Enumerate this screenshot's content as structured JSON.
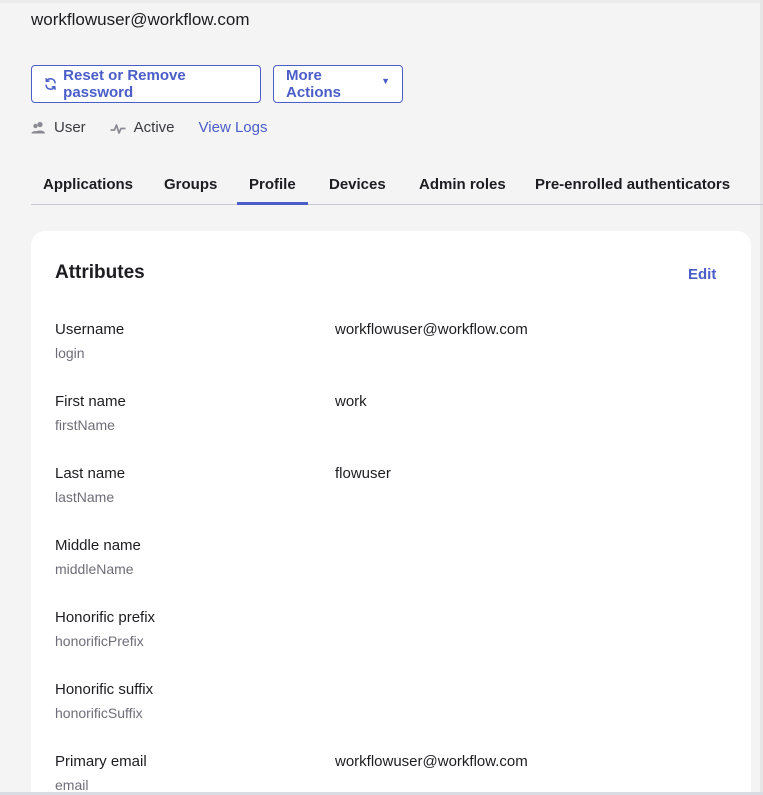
{
  "header": {
    "email": "workflowuser@workflow.com"
  },
  "actions": {
    "reset_label": "Reset or Remove password",
    "more_label": "More Actions"
  },
  "meta": {
    "role": "User",
    "status": "Active",
    "view_logs": "View Logs"
  },
  "tabs": [
    {
      "label": "Applications",
      "active": false
    },
    {
      "label": "Groups",
      "active": false
    },
    {
      "label": "Profile",
      "active": true
    },
    {
      "label": "Devices",
      "active": false
    },
    {
      "label": "Admin roles",
      "active": false
    },
    {
      "label": "Pre-enrolled authenticators",
      "active": false
    }
  ],
  "card": {
    "title": "Attributes",
    "edit": "Edit",
    "attributes": [
      {
        "label": "Username",
        "key": "login",
        "value": "workflowuser@workflow.com"
      },
      {
        "label": "First name",
        "key": "firstName",
        "value": "work"
      },
      {
        "label": "Last name",
        "key": "lastName",
        "value": "flowuser"
      },
      {
        "label": "Middle name",
        "key": "middleName",
        "value": ""
      },
      {
        "label": "Honorific prefix",
        "key": "honorificPrefix",
        "value": ""
      },
      {
        "label": "Honorific suffix",
        "key": "honorificSuffix",
        "value": ""
      },
      {
        "label": "Primary email",
        "key": "email",
        "value": "workflowuser@workflow.com"
      }
    ]
  },
  "colors": {
    "accent": "#4a5dc8",
    "background": "#f4f4f4",
    "card": "#ffffff"
  },
  "icons": {
    "reset": "refresh-icon",
    "more": "caret-down-icon",
    "role": "user-icon",
    "status": "activity-icon"
  }
}
